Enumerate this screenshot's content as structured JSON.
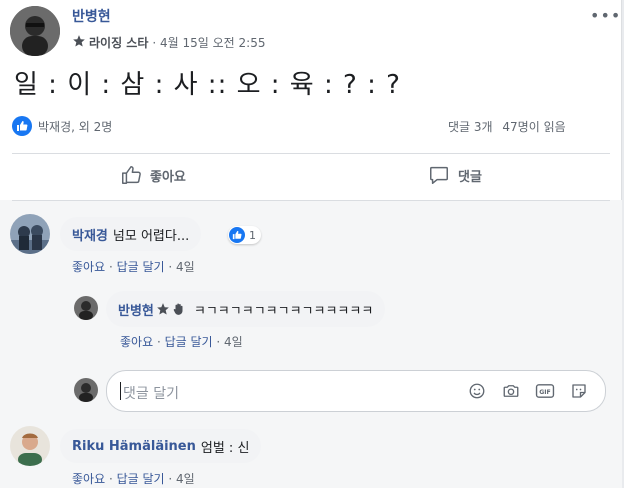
{
  "post": {
    "author": "반병현",
    "badge": "라이징 스타",
    "timestamp": "· 4월 15일 오전 2:55",
    "more": "•••",
    "text": "일 : 이 : 삼 : 사 :: 오 : 육 : ? : ?",
    "reactors": "박재경, 외 2명",
    "comment_count": "댓글 3개",
    "views": "47명이 읽음"
  },
  "actions": {
    "like": "좋아요",
    "comment": "댓글"
  },
  "comments": [
    {
      "name": "박재경",
      "text": "넘모 어렵다...",
      "reaction_count": "1",
      "like": "좋아요",
      "reply": "답글 달기",
      "time": "4일",
      "replies": [
        {
          "name": "반병현",
          "text": "ㅋㄱㅋㄱㅋㄱㅋㄱㅋㄱㅋㅋㅋㅋㅋ",
          "like": "좋아요",
          "reply": "답글 달기",
          "time": "4일"
        }
      ]
    },
    {
      "name": "Riku Hämäläinen",
      "text": "엄벌 : 신",
      "like": "좋아요",
      "reply": "답글 달기",
      "time": "4일"
    }
  ],
  "reply_input": {
    "placeholder": "댓글 달기"
  },
  "colors": {
    "brand": "#1877f2",
    "link": "#385898",
    "muted": "#606770"
  },
  "icons": [
    "star-icon",
    "wave-icon",
    "like-icon",
    "comment-icon",
    "emoji-icon",
    "camera-icon",
    "gif-icon",
    "sticker-icon",
    "more-icon"
  ]
}
